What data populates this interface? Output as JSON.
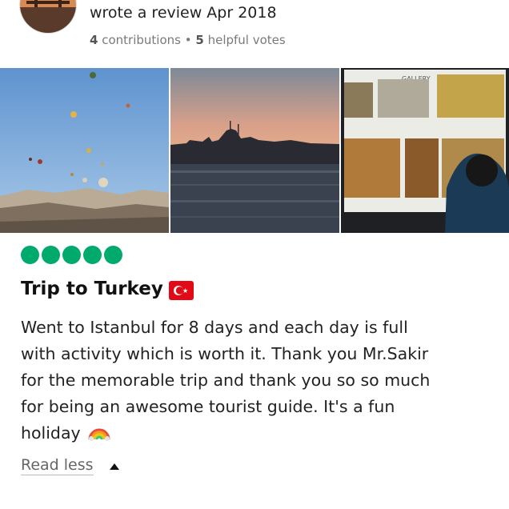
{
  "review": {
    "action_text": "wrote a review Apr 2018",
    "contributions_count": "4",
    "contributions_label": "contributions",
    "separator": "•",
    "helpful_count": "5",
    "helpful_label": "helpful votes"
  },
  "photos": [
    {
      "subject": "hot-air-balloons",
      "gallery_sign": ""
    },
    {
      "subject": "istanbul-skyline-sunset",
      "gallery_sign": ""
    },
    {
      "subject": "museum-gallery",
      "gallery_sign": "GALLERY"
    }
  ],
  "rating": {
    "value": 5,
    "max": 5,
    "color": "#00aa6c"
  },
  "title": "Trip to Turkey",
  "flag_icon": "turkey-flag-icon",
  "body_lines": [
    "Went to Istanbul for 8 days and each day is full",
    "with activity which is worth it. Thank you Mr.Sakir",
    "for the memorable trip and thank you so so much",
    "for being an awesome tourist guide. It's a fun",
    "holiday"
  ],
  "body_end_icon": "rainbow-icon",
  "read_less_label": "Read less",
  "read_less_icon": "caret-up-icon"
}
